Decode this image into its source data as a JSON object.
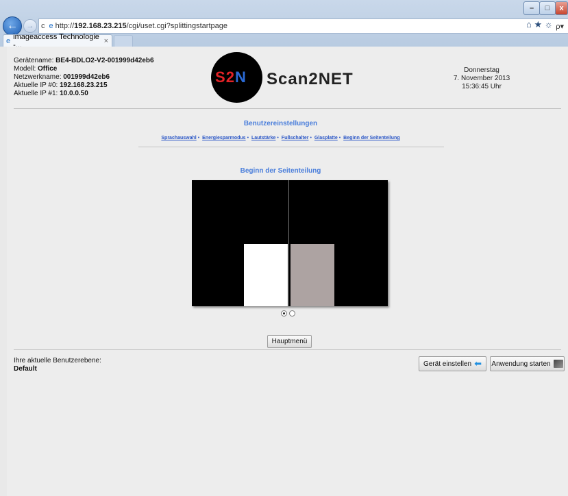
{
  "window": {
    "min_label": "–",
    "max_label": "□",
    "close_label": "x"
  },
  "nav": {
    "back_icon": "arrow-left",
    "forward_icon": "arrow-right",
    "url_prefix": "http://",
    "url_host": "192.168.23.215",
    "url_path": "/cgi/uset.cgi?splittingstartpage",
    "search_label": "ρ▾",
    "home_icon": "⌂",
    "star_icon": "★",
    "gear_icon": "☼"
  },
  "tab": {
    "title": "imageaccess Technologie -...",
    "close": "×"
  },
  "device": {
    "name_label": "Gerätename:",
    "name": "BE4-BDLO2-V2-001999d42eb6",
    "model_label": "Modell:",
    "model": "Office",
    "net_label": "Netzwerkname:",
    "net": "001999d42eb6",
    "ip0_label": "Aktuelle IP #0:",
    "ip0": "192.168.23.215",
    "ip1_label": "Aktuelle IP #1:",
    "ip1": "10.0.0.50"
  },
  "logo": {
    "mark_s": "S",
    "mark_2": "2",
    "mark_n": "N",
    "text": "Scan2NET"
  },
  "date": {
    "day": "Donnerstag",
    "date": "7. November 2013",
    "time": "15:36:45 Uhr"
  },
  "section_title": "Benutzereinstellungen",
  "nav_links": [
    "Sprachauswahl",
    "Energiesparmodus",
    "Lautstärke",
    "Fußschalter",
    "Glasplatte",
    "Beginn der Seitenteilung"
  ],
  "nav_sep": "•",
  "subsection_title": "Beginn der Seitenteilung",
  "radios": {
    "selected": 0,
    "count": 2
  },
  "main_menu_label": "Hauptmenü",
  "level": {
    "label": "Ihre aktuelle Benutzerebene:",
    "value": "Default"
  },
  "buttons": {
    "configure": "Gerät einstellen",
    "start": "Anwendung starten"
  }
}
